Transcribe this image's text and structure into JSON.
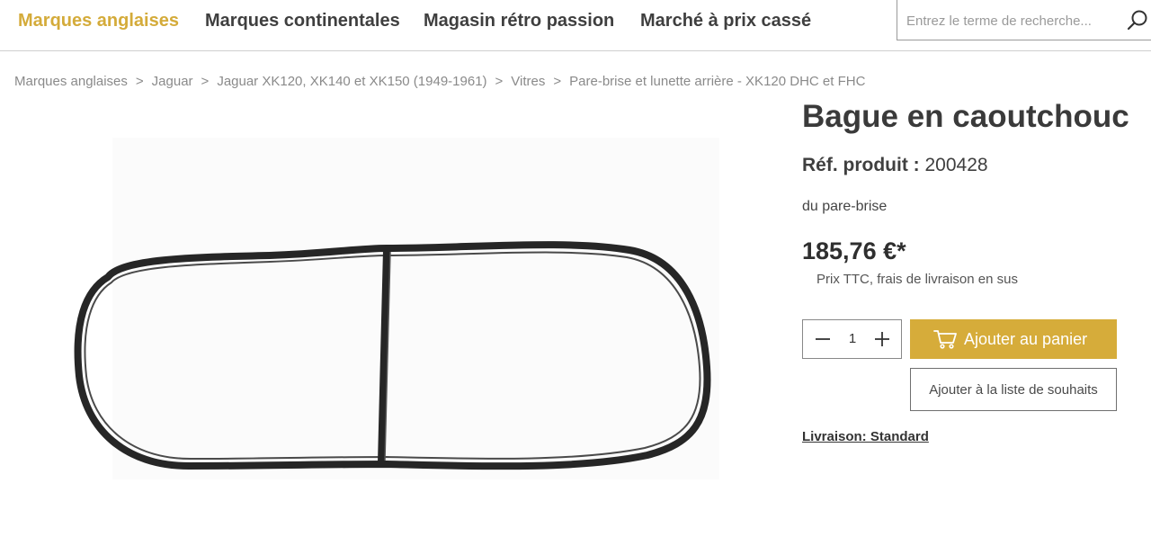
{
  "nav": {
    "items": [
      {
        "label": "Marques anglaises",
        "active": true
      },
      {
        "label": "Marques continentales",
        "active": false
      },
      {
        "label": "Magasin rétro passion",
        "active": false
      },
      {
        "label": "Marché à prix cassé",
        "active": false
      }
    ]
  },
  "search": {
    "placeholder": "Entrez le terme de recherche...",
    "icon": "search-icon"
  },
  "breadcrumb": {
    "items": [
      "Marques anglaises",
      "Jaguar",
      "Jaguar XK120, XK140 et XK150 (1949-1961)",
      "Vitres",
      "Pare-brise et lunette arrière - XK120 DHC et FHC"
    ],
    "separator": ">"
  },
  "product": {
    "title": "Bague en caoutchouc",
    "ref_label": "Réf. produit :",
    "ref_value": "200428",
    "description": "du pare-brise",
    "price": "185,76 €*",
    "price_note": "Prix TTC, frais de livraison en sus",
    "image_subject": "windscreen rubber seal"
  },
  "cart": {
    "quantity": "1",
    "add_label": "Ajouter au panier",
    "wishlist_label": "Ajouter à la liste de souhaits",
    "delivery_label": "Livraison: Standard"
  },
  "colors": {
    "accent": "#d6ac3a",
    "nav_active": "#d4ab3a",
    "text": "#333333"
  }
}
